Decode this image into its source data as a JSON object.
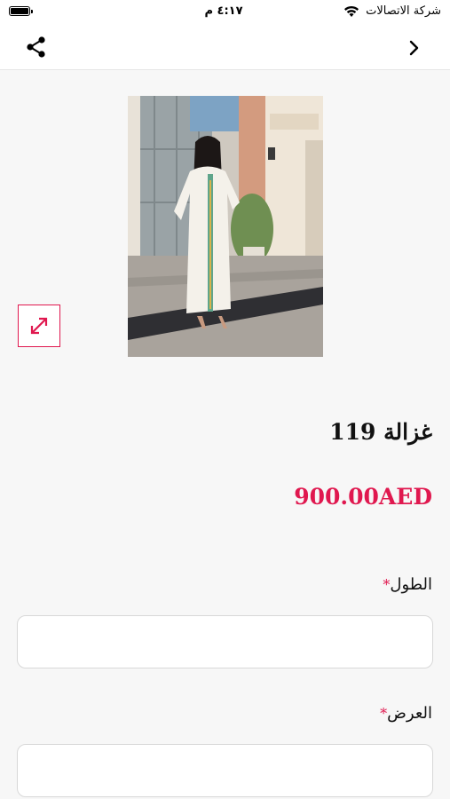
{
  "status_bar": {
    "time": "٤:١٧ م",
    "carrier": "شركة الاتصالات"
  },
  "nav": {
    "back_icon": "chevron-right-icon",
    "share_icon": "share-icon"
  },
  "product": {
    "image_icon": "product-photo",
    "expand_icon": "expand-arrows-icon",
    "title": "غزالة 119",
    "price": "900.00AED"
  },
  "form": {
    "fields": [
      {
        "label": "الطول",
        "required_mark": "*",
        "value": ""
      },
      {
        "label": "العرض",
        "required_mark": "*",
        "value": ""
      }
    ]
  },
  "colors": {
    "accent": "#e0184f",
    "background": "#f7f7f7"
  }
}
